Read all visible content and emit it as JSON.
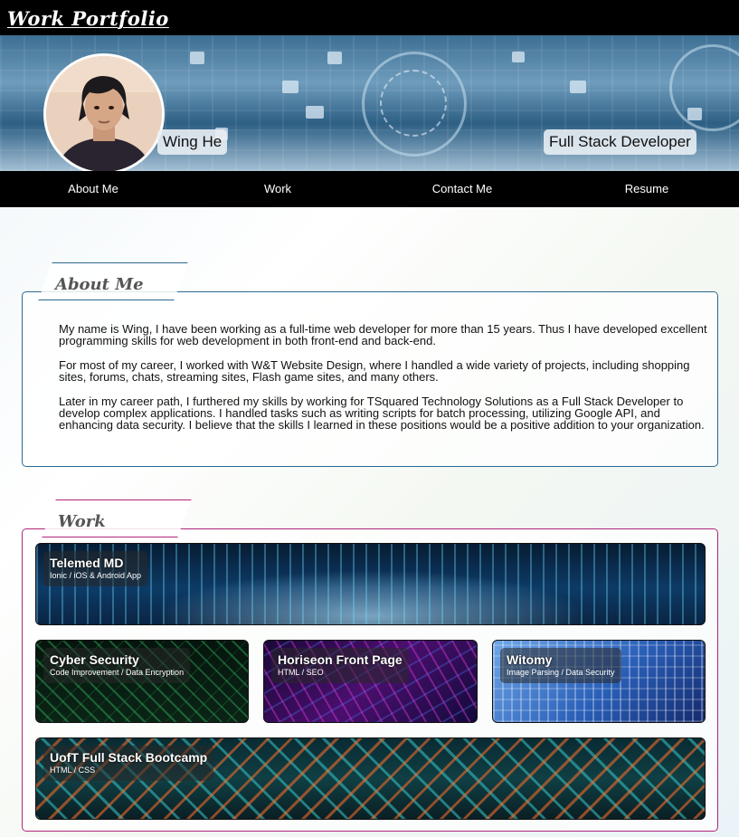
{
  "header": {
    "site_title": "Work Portfolio"
  },
  "banner": {
    "name": "Wing He",
    "role": "Full Stack Developer"
  },
  "nav": {
    "items": [
      "About Me",
      "Work",
      "Contact Me",
      "Resume"
    ]
  },
  "about": {
    "heading": "About Me",
    "paragraphs": [
      "My name is Wing, I have been working as a full-time web developer for more than 15 years. Thus I have developed excellent programming skills for web development in both front-end and back-end.",
      "For most of my career, I worked with W&T Website Design, where I handled a wide variety of projects, including shopping sites, forums, chats, streaming sites, Flash game sites, and many others.",
      "Later in my career path, I furthered my skills by working for TSquared Technology Solutions as a Full Stack Developer to develop complex applications. I handled tasks such as writing scripts for batch processing, utilizing Google API, and enhancing data security. I believe that the skills I learned in these positions would be a positive addition to your organization."
    ]
  },
  "work": {
    "heading": "Work",
    "projects": [
      {
        "title": "Telemed MD",
        "subtitle": "Ionic / iOS & Android App"
      },
      {
        "title": "Cyber Security",
        "subtitle": "Code Improvement / Data Encryption"
      },
      {
        "title": "Horiseon Front Page",
        "subtitle": "HTML / SEO"
      },
      {
        "title": "Witomy",
        "subtitle": "Image Parsing / Data Security"
      },
      {
        "title": "UofT Full Stack Bootcamp",
        "subtitle": "HTML / CSS"
      }
    ]
  },
  "colors": {
    "about_border": "#2b6a8f",
    "work_border": "#b0257a",
    "bars": "#000000"
  }
}
